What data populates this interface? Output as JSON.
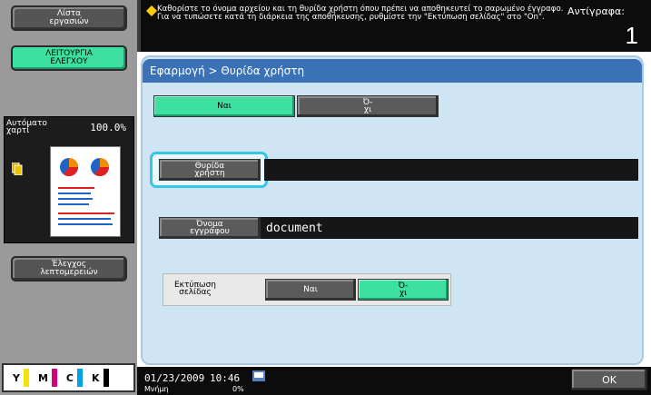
{
  "sidebar": {
    "job_list_label": "Λίστα\nεργασιών",
    "check_details_label": "ΛΕΙΤΟΥΡΓΙΑ\nΕΛΕΓΧΟΥ",
    "paper": {
      "label": "Αυτόματο\nχαρτί",
      "percent": "100.0%"
    },
    "details_label": "Έλεγχος\nλεπτομερειών",
    "toner": [
      "Y",
      "M",
      "C",
      "K"
    ],
    "toner_colors": [
      "#f5e400",
      "#d6007e",
      "#00a3e0",
      "#000000"
    ]
  },
  "header": {
    "message": "Καθορίστε το όνομα αρχείου και τη θυρίδα χρήστη όπου πρέπει να αποθηκευτεί το σαρωμένο έγγραφο. Για να τυπώσετε κατά τη διάρκεια της αποθήκευσης, ρυθμίστε την \"Εκτύπωση σελίδας\" στο \"On\".",
    "copies_label": "Αντίγραφα:",
    "copies_value": "1"
  },
  "main": {
    "breadcrumb": "Εφαρμογή > Θυρίδα χρήστη",
    "yes_label": "Ναι",
    "no_label": "Ό-\nχι",
    "user_box_label": "Θυρίδα\nχρήστη",
    "user_box_value": "",
    "doc_name_label": "Όνομα\nεγγράφου",
    "doc_name_value": "document",
    "print_page_label": "Εκτύπωση\nσελίδας",
    "print_yes_label": "Ναι",
    "print_no_label": "Ό-\nχι"
  },
  "status": {
    "date": "01/23/2009",
    "time": "10:46",
    "memory_label": "Μνήμη",
    "memory_value": "0%",
    "ok_label": "OK"
  },
  "colors": {
    "accent_green": "#3de0a0",
    "title_blue": "#3b72b6",
    "highlight_cyan": "#39c5e4"
  }
}
